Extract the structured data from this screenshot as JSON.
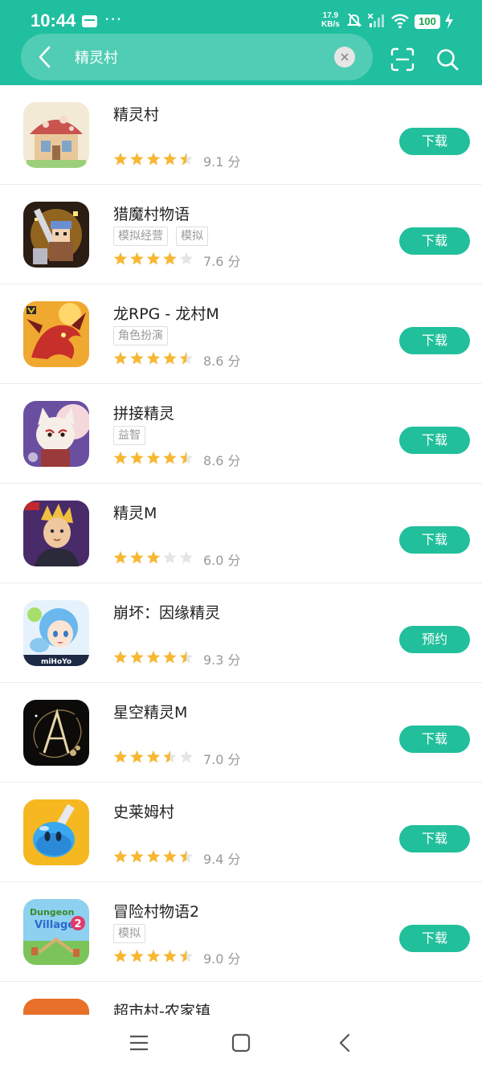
{
  "status": {
    "time": "10:44",
    "dots": "···",
    "net_speed_value": "17.9",
    "net_speed_unit": "KB/s",
    "battery": "100"
  },
  "search": {
    "query": "精灵村"
  },
  "colors": {
    "accent": "#20bfa0",
    "button": "#21bf9b",
    "star": "#f7b731",
    "star_empty": "#e5e5e5"
  },
  "apps": [
    {
      "name": "精灵村",
      "tags": [],
      "rating": 4.5,
      "score": "9.1 分",
      "action": "下载",
      "icon": "village-house-icon"
    },
    {
      "name": "猎魔村物语",
      "tags": [
        "模拟经营",
        "模拟"
      ],
      "rating": 4,
      "score": "7.6 分",
      "action": "下载",
      "icon": "pixel-knight-icon"
    },
    {
      "name": "龙RPG - 龙村M",
      "tags": [
        "角色扮演"
      ],
      "rating": 4.5,
      "score": "8.6 分",
      "action": "下载",
      "icon": "red-dragon-icon"
    },
    {
      "name": "拼接精灵",
      "tags": [
        "益智"
      ],
      "rating": 4.5,
      "score": "8.6 分",
      "action": "下载",
      "icon": "fox-spirit-icon"
    },
    {
      "name": "精灵M",
      "tags": [],
      "rating": 3,
      "score": "6.0 分",
      "action": "下载",
      "icon": "hero-portrait-icon"
    },
    {
      "name": "崩坏：因缘精灵",
      "tags": [],
      "rating": 4.5,
      "score": "9.3 分",
      "action": "预约",
      "icon": "anime-girl-icon"
    },
    {
      "name": "星空精灵M",
      "tags": [],
      "rating": 3.5,
      "score": "7.0 分",
      "action": "下载",
      "icon": "letter-a-icon"
    },
    {
      "name": "史莱姆村",
      "tags": [],
      "rating": 4.5,
      "score": "9.4 分",
      "action": "下载",
      "icon": "blue-slime-icon"
    },
    {
      "name": "冒险村物语2",
      "tags": [
        "模拟"
      ],
      "rating": 4.5,
      "score": "9.0 分",
      "action": "下载",
      "icon": "dungeon-village-icon"
    },
    {
      "name": "超市村-农家镇",
      "tags": [],
      "rating": 0,
      "score": "",
      "action": "",
      "icon": "market-village-icon"
    }
  ],
  "icon_labels": {
    "mihoyo": "miHoYo",
    "dungeon_title": "Dungeon",
    "village_title": "Village"
  }
}
